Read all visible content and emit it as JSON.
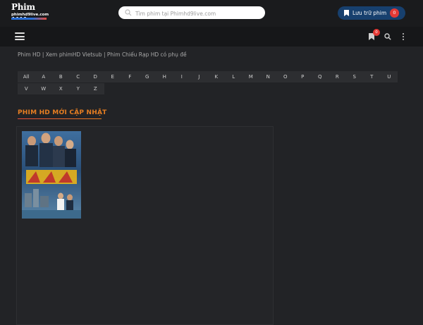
{
  "header": {
    "logo_main": "Phim HD",
    "logo_sub": "phimhd9live.com",
    "search_placeholder": "Tìm phim tại Phimhd9live.com",
    "save_button_label": "Lưu trữ phim",
    "save_badge_count": "0"
  },
  "navbar": {
    "bookmark_badge_count": "0",
    "icons": [
      "menu-icon",
      "bookmark-icon",
      "search-icon",
      "more-vertical-icon"
    ]
  },
  "breadcrumb": "Phim HD | Xem phimHD Vietsub | Phim Chiếu Rạp HD có phụ đề",
  "alphabet": {
    "row1": [
      "All",
      "A",
      "B",
      "C",
      "D",
      "E",
      "F",
      "G",
      "H",
      "I",
      "J",
      "K",
      "L",
      "M",
      "N",
      "O",
      "P",
      "Q",
      "R",
      "S",
      "T",
      "U"
    ],
    "row2": [
      "V",
      "W",
      "X",
      "Y",
      "Z"
    ]
  },
  "section": {
    "title": "PHIM HD MỚI CẬP NHẬT"
  },
  "colors": {
    "background": "#222326",
    "accent_orange": "#e67e22",
    "badge_red": "#e53935",
    "save_button_blue": "#17406e"
  }
}
